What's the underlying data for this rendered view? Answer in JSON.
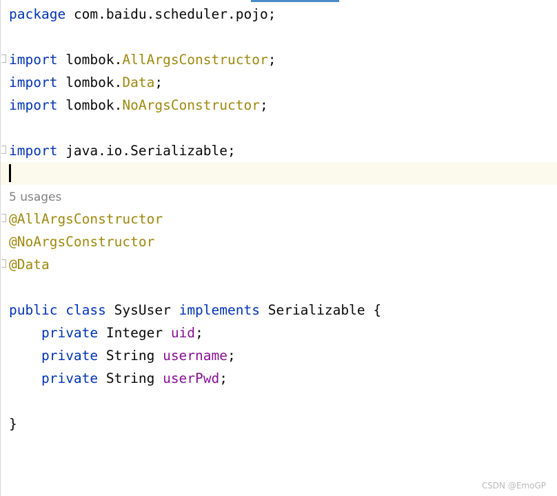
{
  "editor": {
    "usages_hint": "5 usages",
    "lines": {
      "package_kw": "package",
      "package_name": " com.baidu.scheduler.pojo;",
      "import_kw": "import",
      "import1_pkg": " lombok.",
      "import1_cls": "AllArgsConstructor",
      "import2_pkg": " lombok.",
      "import2_cls": "Data",
      "import3_pkg": " lombok.",
      "import3_cls": "NoArgsConstructor",
      "import4_rest": " java.io.Serializable;",
      "semicolon": ";",
      "ann1": "@AllArgsConstructor",
      "ann2": "@NoArgsConstructor",
      "ann3": "@Data",
      "public_kw": "public",
      "class_kw": " class",
      "class_name": " SysUser ",
      "implements_kw": "implements",
      "iface_rest": " Serializable {",
      "indent": "    ",
      "private_kw": "private",
      "f1_type": " Integer ",
      "f1_name": "uid",
      "f2_type": " String ",
      "f2_name": "username",
      "f3_type": " String ",
      "f3_name": "userPwd",
      "close_brace": "}"
    }
  },
  "watermark": "CSDN @EmoGP",
  "colors": {
    "keyword": "#0033b3",
    "annotation": "#9e880d",
    "field": "#871094",
    "text": "#080808",
    "current_line": "#fcfaed"
  }
}
